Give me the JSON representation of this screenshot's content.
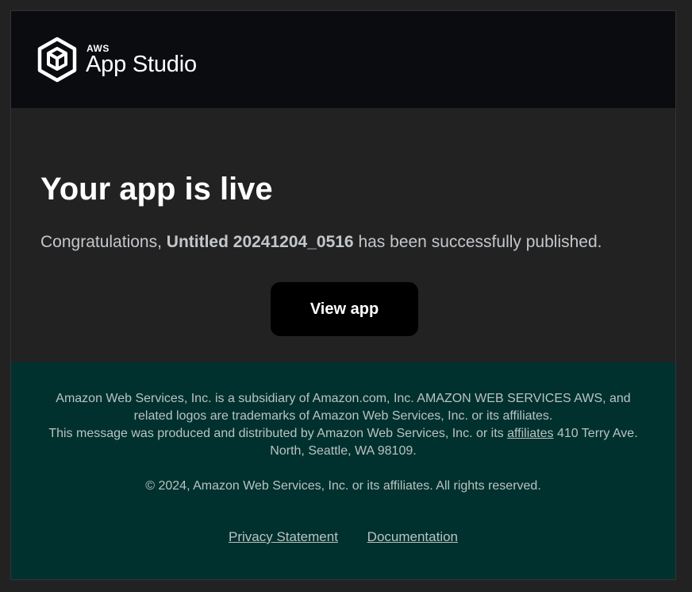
{
  "header": {
    "brand_prefix": "AWS",
    "brand_name": "App Studio"
  },
  "main": {
    "headline": "Your app is live",
    "message_prefix": "Congratulations,",
    "app_name": "Untitled 20241204_0516",
    "message_suffix": "has been successfully published.",
    "view_button_label": "View app"
  },
  "footer": {
    "legal_line1": "Amazon Web Services, Inc. is a subsidiary of Amazon.com, Inc. AMAZON WEB SERVICES AWS, and related logos are trademarks of Amazon Web Services, Inc. or its affiliates.",
    "legal_line2_prefix": "This message was produced and distributed by Amazon Web Services, Inc. or its",
    "legal_affiliates_link": "affiliates",
    "legal_line2_suffix": "410 Terry Ave. North, Seattle, WA 98109.",
    "copyright": "© 2024, Amazon Web Services, Inc. or its affiliates. All rights reserved.",
    "links": {
      "privacy": "Privacy Statement",
      "documentation": "Documentation"
    }
  },
  "colors": {
    "header_bg": "#0b0c10",
    "body_bg": "#222222",
    "footer_bg": "#00312e",
    "button_bg": "#000000"
  }
}
